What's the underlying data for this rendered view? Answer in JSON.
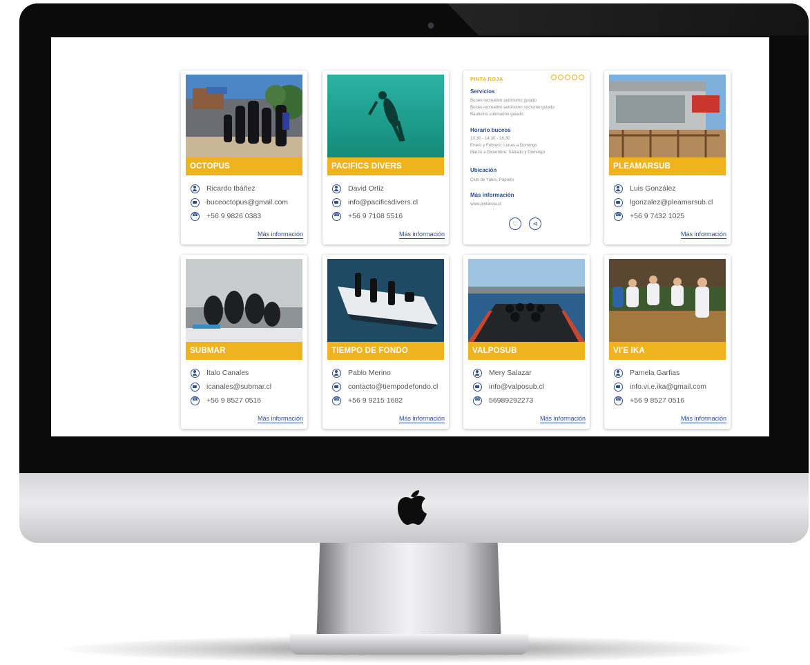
{
  "cards_row1": [
    {
      "name": "OCTOPUS",
      "contact": "Ricardo Ibáñez",
      "email": "buceoctopus@gmail.com",
      "phone": "+56 9 9826 0383",
      "more": "Más información"
    },
    {
      "name": "PACIFICS DIVERS",
      "contact": "David Ortiz",
      "email": "info@pacificsdivers.cl",
      "phone": "+56 9 7108 5516",
      "more": "Más información"
    },
    {
      "name": "PLEAMARSUB",
      "contact": "Luis González",
      "email": "lgonzalez@pleamarsub.cl",
      "phone": "+56 9 7432 1025",
      "more": "Más información"
    }
  ],
  "cards_row2": [
    {
      "name": "SUBMAR",
      "contact": "Ítalo Canales",
      "email": "icanales@submar.cl",
      "phone": "+56 9 8527 0516",
      "more": "Más información"
    },
    {
      "name": "TIEMPO DE FONDO",
      "contact": "Pablo Merino",
      "email": "contacto@tiempodefondo.cl",
      "phone": "+56 9 9215 1682",
      "more": "Más información"
    },
    {
      "name": "VALPOSUB",
      "contact": "Mery Salazar",
      "email": "info@valposub.cl",
      "phone": "56989292273",
      "more": "Más información"
    },
    {
      "name": "VI'E IKA",
      "contact": "Pamela Garfias",
      "email": "info.vi.e.ika@gmail.com",
      "phone": "+56 9 8527 0516",
      "more": "Más información"
    }
  ],
  "info_card": {
    "brand": "PINTA ROJA",
    "servicios_title": "Servicios",
    "servicios": [
      "Buceo recreativo autónomo guiado",
      "Buceo recreativo autónomo nocturno guiado",
      "Bautismo submarino guiado"
    ],
    "horario_title": "Horario buceos",
    "horario": [
      "10:30 - 14:30 - 16:30",
      "Enero y Febrero: Lunes a Domingo",
      "Marzo a Diciembre: Sábado y Domingo"
    ],
    "ubicacion_title": "Ubicación",
    "ubicacion": "Club de Yates, Papudo",
    "mas_title": "Más información",
    "mas": "www.pintaroja.cl"
  },
  "colors": {
    "accent": "#efb31e",
    "link": "#2c4d8f"
  }
}
